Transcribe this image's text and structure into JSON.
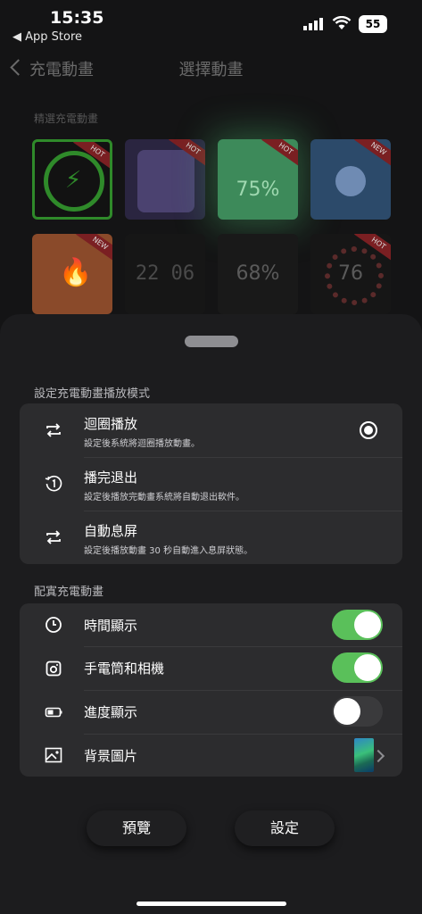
{
  "status_bar": {
    "time": "15:35",
    "back_app": "◀ App Store",
    "battery": "55"
  },
  "nav": {
    "back_label": "充電動畫",
    "title": "選擇動畫"
  },
  "background": {
    "section_title": "精選充電動畫",
    "tiles": [
      {
        "badge": "HOT"
      },
      {
        "badge": "HOT"
      },
      {
        "badge": "HOT",
        "text": "75%"
      },
      {
        "badge": "NEW"
      },
      {
        "badge": "NEW"
      },
      {
        "text": "22 06"
      },
      {
        "text": "68%"
      },
      {
        "badge": "HOT",
        "text": "76"
      }
    ]
  },
  "sheet": {
    "mode_section_title": "設定充電動畫播放模式",
    "modes": [
      {
        "title": "迴圈播放",
        "subtitle": "設定後系統將迴圈播放動畫。",
        "icon": "loop-icon",
        "selected": true
      },
      {
        "title": "播完退出",
        "subtitle": "設定後播放完動畫系統將自動退出軟件。",
        "icon": "play-once-icon",
        "selected": false
      },
      {
        "title": "自動息屏",
        "subtitle": "設定後播放動畫 30 秒自動進入息屏狀態。",
        "icon": "loop-icon",
        "selected": false
      }
    ],
    "options_section_title": "配寘充電動畫",
    "options": [
      {
        "title": "時間顯示",
        "icon": "clock-icon",
        "enabled": true
      },
      {
        "title": "手電筒和相機",
        "icon": "camera-icon",
        "enabled": true
      },
      {
        "title": "進度顯示",
        "icon": "battery-icon",
        "enabled": false
      },
      {
        "title": "背景圖片",
        "icon": "image-icon"
      }
    ],
    "preview_button": "預覽",
    "set_button": "設定"
  },
  "colors": {
    "toggle_on": "#5ac05a",
    "sheet_bg": "#1c1c1e",
    "card_bg": "#2c2c2e"
  }
}
